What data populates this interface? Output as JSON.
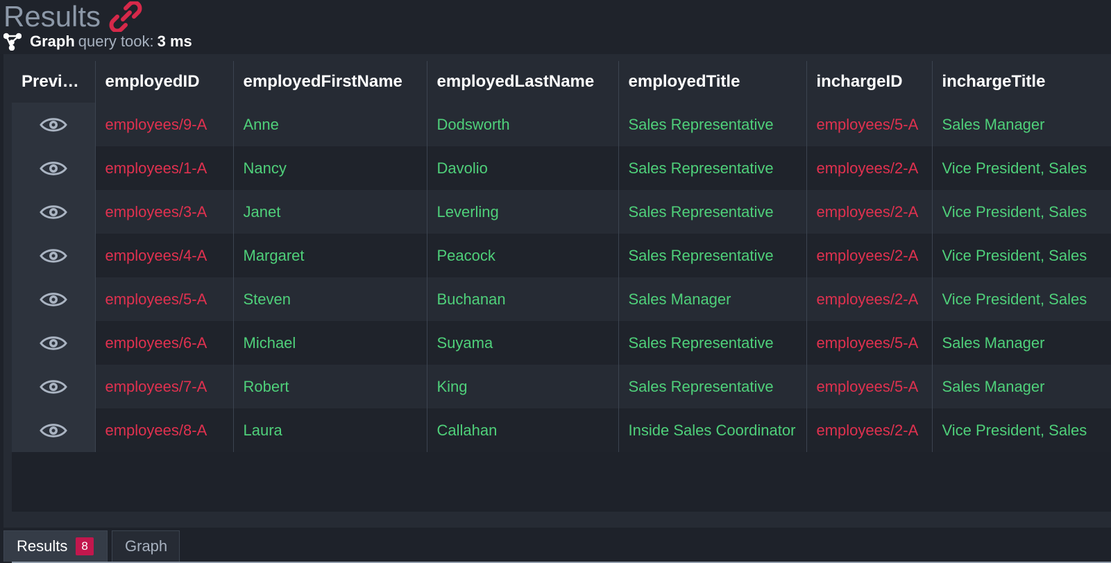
{
  "header": {
    "title": "Results",
    "query_mode": "Graph",
    "query_took_label": "query took:",
    "query_time": "3 ms"
  },
  "table": {
    "columns": [
      "Previe...",
      "employedID",
      "employedFirstName",
      "employedLastName",
      "employedTitle",
      "inchargeID",
      "inchargeTitle"
    ],
    "rows": [
      {
        "employedID": "employees/9-A",
        "first": "Anne",
        "last": "Dodsworth",
        "title": "Sales Representative",
        "inchargeID": "employees/5-A",
        "inchargeTitle": "Sales Manager"
      },
      {
        "employedID": "employees/1-A",
        "first": "Nancy",
        "last": "Davolio",
        "title": "Sales Representative",
        "inchargeID": "employees/2-A",
        "inchargeTitle": "Vice President, Sales"
      },
      {
        "employedID": "employees/3-A",
        "first": "Janet",
        "last": "Leverling",
        "title": "Sales Representative",
        "inchargeID": "employees/2-A",
        "inchargeTitle": "Vice President, Sales"
      },
      {
        "employedID": "employees/4-A",
        "first": "Margaret",
        "last": "Peacock",
        "title": "Sales Representative",
        "inchargeID": "employees/2-A",
        "inchargeTitle": "Vice President, Sales"
      },
      {
        "employedID": "employees/5-A",
        "first": "Steven",
        "last": "Buchanan",
        "title": "Sales Manager",
        "inchargeID": "employees/2-A",
        "inchargeTitle": "Vice President, Sales"
      },
      {
        "employedID": "employees/6-A",
        "first": "Michael",
        "last": "Suyama",
        "title": "Sales Representative",
        "inchargeID": "employees/5-A",
        "inchargeTitle": "Sales Manager"
      },
      {
        "employedID": "employees/7-A",
        "first": "Robert",
        "last": "King",
        "title": "Sales Representative",
        "inchargeID": "employees/5-A",
        "inchargeTitle": "Sales Manager"
      },
      {
        "employedID": "employees/8-A",
        "first": "Laura",
        "last": "Callahan",
        "title": "Inside Sales Coordinator",
        "inchargeID": "employees/2-A",
        "inchargeTitle": "Vice President, Sales"
      }
    ]
  },
  "tabs": {
    "results_label": "Results",
    "results_count": "8",
    "graph_label": "Graph"
  },
  "colors": {
    "id_text": "#e0314f",
    "value_text": "#4fd07a",
    "badge": "#c2174d"
  },
  "icons": {
    "title": "link-icon",
    "query": "graph-icon",
    "preview": "eye-icon"
  }
}
